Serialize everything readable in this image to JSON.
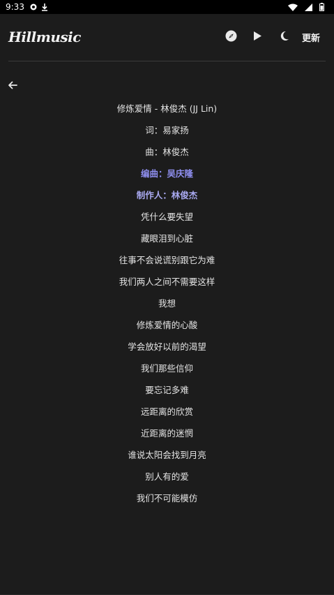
{
  "status_bar": {
    "time": "9:33",
    "icons": [
      "shield-notification-icon",
      "download-icon",
      "wifi-icon",
      "signal-icon",
      "battery-icon"
    ]
  },
  "header": {
    "logo": "Hillmusic",
    "update_label": "更新",
    "icons": [
      "compass-icon",
      "play-icon",
      "moon-icon"
    ]
  },
  "lyrics": {
    "title": "修炼爱情 - 林俊杰 (JJ Lin)",
    "lines": [
      "词：易家扬",
      "曲：林俊杰",
      "编曲：吴庆隆",
      "制作人：林俊杰",
      "凭什么要失望",
      "藏眼泪到心脏",
      "往事不会说谎别跟它为难",
      "我们两人之间不需要这样",
      "我想",
      "修炼爱情的心酸",
      "学会放好以前的渴望",
      "我们那些信仰",
      "要忘记多难",
      "远距离的欣赏",
      "近距离的迷惘",
      "谁说太阳会找到月亮",
      "别人有的爱",
      "我们不可能模仿"
    ]
  },
  "colors": {
    "background": "#1c1c1c",
    "text": "#e4e4e4",
    "highlight_1": "#8f8ff0",
    "highlight_2": "#a9a9f0"
  }
}
